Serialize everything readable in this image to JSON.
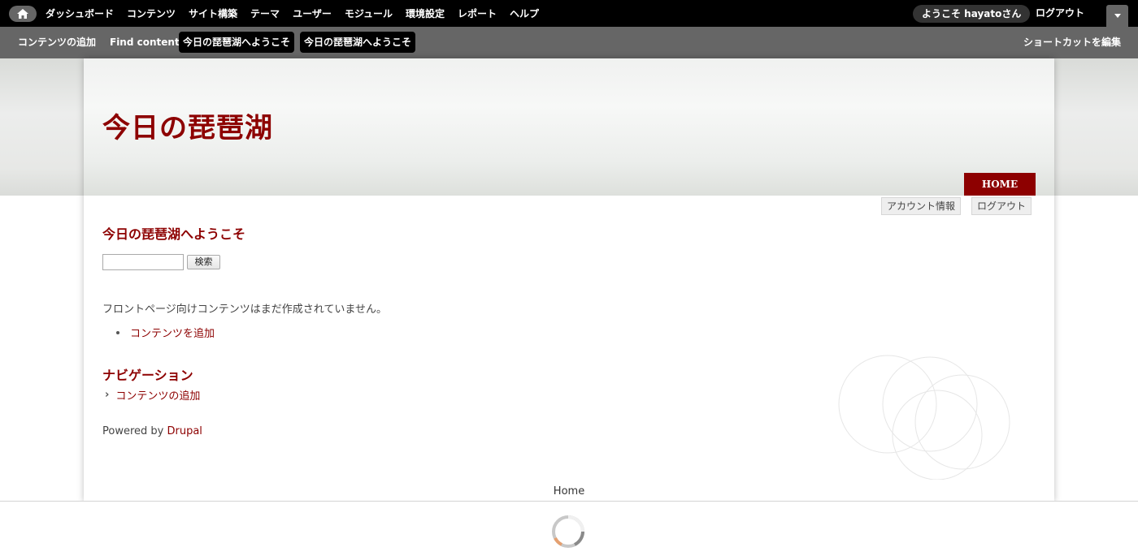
{
  "toolbar": {
    "menu": [
      "ダッシュボード",
      "コンテンツ",
      "サイト構築",
      "テーマ",
      "ユーザー",
      "モジュール",
      "環境設定",
      "レポート",
      "ヘルプ"
    ],
    "welcome": "ようこそ hayatoさん",
    "logout": "ログアウト"
  },
  "shortcuts": {
    "items": [
      "コンテンツの追加",
      "Find content",
      "今日の琵琶湖へようこそ",
      "今日の琵琶湖へようこそ"
    ],
    "edit": "ショートカットを編集"
  },
  "site": {
    "name": "今日の琵琶湖",
    "home_tab": "HOME",
    "account": "アカウント情報",
    "logout": "ログアウト"
  },
  "content": {
    "block_title": "今日の琵琶湖へようこそ",
    "search_button": "検索",
    "empty_message": "フロントページ向けコンテンツはまだ作成されていません。",
    "add_content": "コンテンツを追加"
  },
  "navigation": {
    "title": "ナビゲーション",
    "item": "コンテンツの追加"
  },
  "powered": {
    "prefix": "Powered by ",
    "link": "Drupal"
  },
  "footer": {
    "home": "Home"
  },
  "colors": {
    "brand": "#8d0000",
    "toolbar": "#000000",
    "shortcut_bar": "#666666"
  }
}
